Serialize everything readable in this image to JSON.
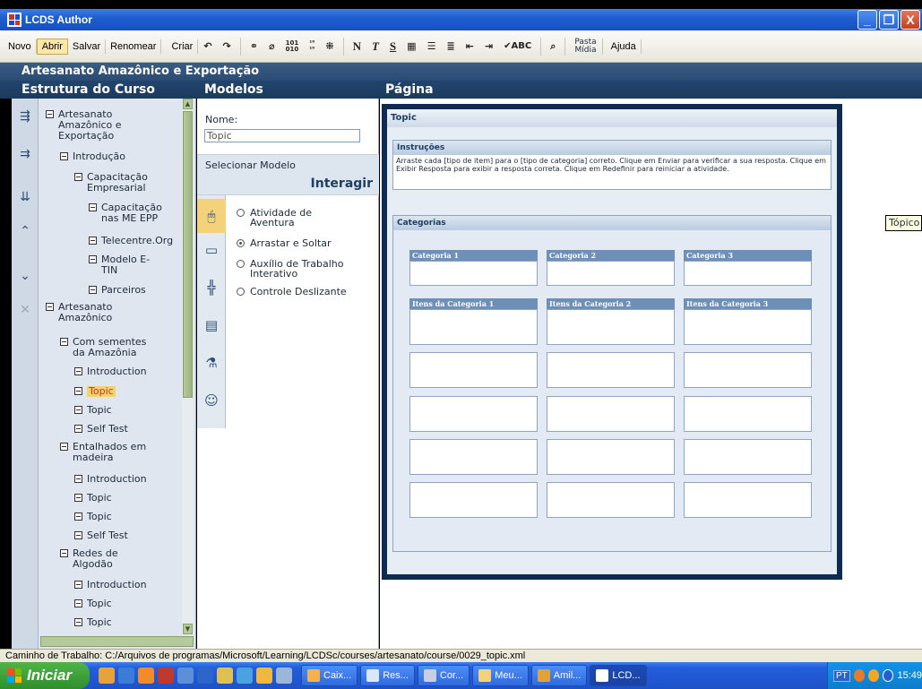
{
  "window": {
    "title": "LCDS Author",
    "buttons": [
      "_",
      "❐",
      "X"
    ]
  },
  "toolbar": {
    "novo": "Novo",
    "abrir": "Abrir",
    "salvar": "Salvar",
    "renomear": "Renomear",
    "criar": "Criar",
    "bold": "N",
    "italic": "T",
    "underline": "S",
    "spell": "✔ABC",
    "pasta_midia_1": "Pasta",
    "pasta_midia_2": "Mídia",
    "ajuda": "Ajuda"
  },
  "course_title": "Artesanato Amazônico e Exportação",
  "headers": {
    "structure": "Estrutura do Curso",
    "models": "Modelos",
    "page": "Página"
  },
  "tree": [
    {
      "label": "Artesanato Amazônico e Exportação",
      "level": 0,
      "selected": false
    },
    {
      "label": "Introdução",
      "level": 1,
      "selected": false
    },
    {
      "label": "Capacitação Empresarial",
      "level": 2,
      "selected": false
    },
    {
      "label": "Capacitação nas ME EPP",
      "level": 3,
      "selected": false
    },
    {
      "label": "Telecentre.Org",
      "level": 3,
      "selected": false
    },
    {
      "label": "Modelo E-TIN",
      "level": 3,
      "selected": false
    },
    {
      "label": "Parceiros",
      "level": 3,
      "selected": false
    },
    {
      "label": "Artesanato Amazônico",
      "level": 0,
      "selected": false
    },
    {
      "label": "Com sementes da Amazônia",
      "level": 1,
      "selected": false
    },
    {
      "label": "Introduction",
      "level": 2,
      "selected": false
    },
    {
      "label": "Topic",
      "level": 2,
      "selected": true
    },
    {
      "label": "Topic",
      "level": 2,
      "selected": false
    },
    {
      "label": "Self Test",
      "level": 2,
      "selected": false
    },
    {
      "label": "Entalhados em madeira",
      "level": 1,
      "selected": false
    },
    {
      "label": "Introduction",
      "level": 2,
      "selected": false
    },
    {
      "label": "Topic",
      "level": 2,
      "selected": false
    },
    {
      "label": "Topic",
      "level": 2,
      "selected": false
    },
    {
      "label": "Self Test",
      "level": 2,
      "selected": false
    },
    {
      "label": "Redes de Algodão",
      "level": 1,
      "selected": false
    },
    {
      "label": "Introduction",
      "level": 2,
      "selected": false
    },
    {
      "label": "Topic",
      "level": 2,
      "selected": false
    },
    {
      "label": "Topic",
      "level": 2,
      "selected": false
    }
  ],
  "models": {
    "name_label": "Nome:",
    "name_value": "Topic",
    "select_label": "Selecionar Modelo",
    "category": "Interagir",
    "options": [
      {
        "label": "Atividade de Aventura",
        "checked": false
      },
      {
        "label": "Arrastar e Soltar",
        "checked": true
      },
      {
        "label": "Auxílio de Trabalho Interativo",
        "checked": false
      },
      {
        "label": "Controle Deslizante",
        "checked": false
      }
    ]
  },
  "page": {
    "topic_header": "Topic",
    "instructions_title": "Instruções",
    "instructions_text": "Arraste cada [tipo de item] para o [tipo de categoria] correto. Clique em Enviar para verificar a sua resposta. Clique em Exibir Resposta para exibir a resposta correta. Clique em Redefinir para reiniciar a atividade.",
    "categories_title": "Categorias",
    "categories": [
      "Categoria 1",
      "Categoria 2",
      "Categoria 3"
    ],
    "item_headers": [
      "Itens da Categoria 1",
      "Itens da Categoria 2",
      "Itens da Categoria 3"
    ]
  },
  "tooltip": "Tópico",
  "status": "Caminho de Trabalho: C:/Arquivos de programas/Microsoft/Learning/LCDSc/courses/artesanato/course/0029_topic.xml",
  "taskbar": {
    "start": "Iniciar",
    "tasks": [
      "Caix...",
      "Res...",
      "Cor...",
      "Meu...",
      "Amil...",
      "LCD..."
    ],
    "lang": "PT",
    "clock": "15:49"
  },
  "colors": {
    "title_blue": "#1f5fd0",
    "header_navy": "#1b3a5f",
    "selection_yellow": "#f5d36a",
    "frame_navy": "#0f2b52",
    "category_header": "#6d8fb8"
  }
}
